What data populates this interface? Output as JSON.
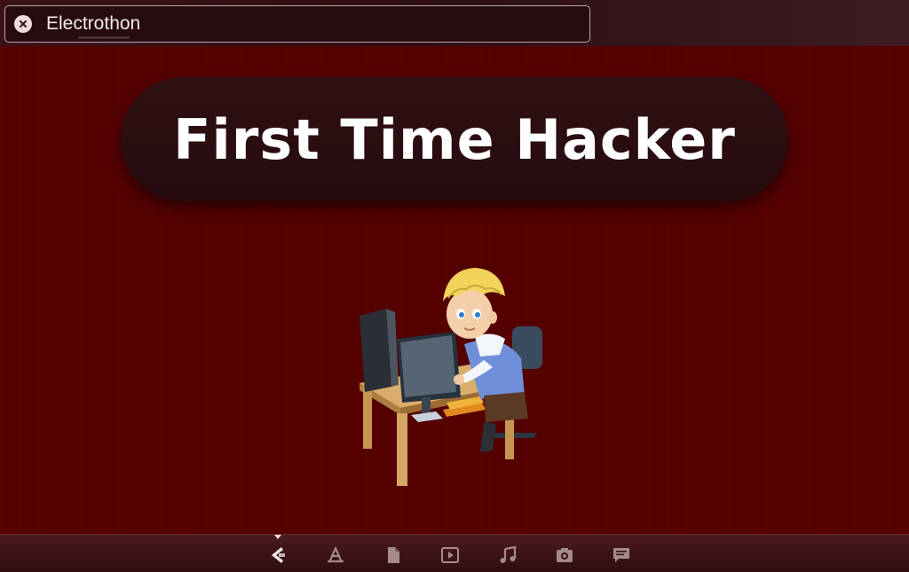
{
  "window": {
    "tab_title": "Electrothon"
  },
  "main": {
    "banner_text": "First Time Hacker",
    "illustration": "developer-at-computer-desk"
  },
  "dock": {
    "active_index": 0,
    "items": [
      {
        "icon": "electrothon-app-icon"
      },
      {
        "icon": "app-store-icon"
      },
      {
        "icon": "document-icon"
      },
      {
        "icon": "video-player-icon"
      },
      {
        "icon": "music-icon"
      },
      {
        "icon": "camera-icon"
      },
      {
        "icon": "chat-icon"
      }
    ]
  },
  "colors": {
    "background": "#550000",
    "banner": "#2a0c0f",
    "banner_text": "#ffffff",
    "dock_icon": "#a58a8c"
  }
}
